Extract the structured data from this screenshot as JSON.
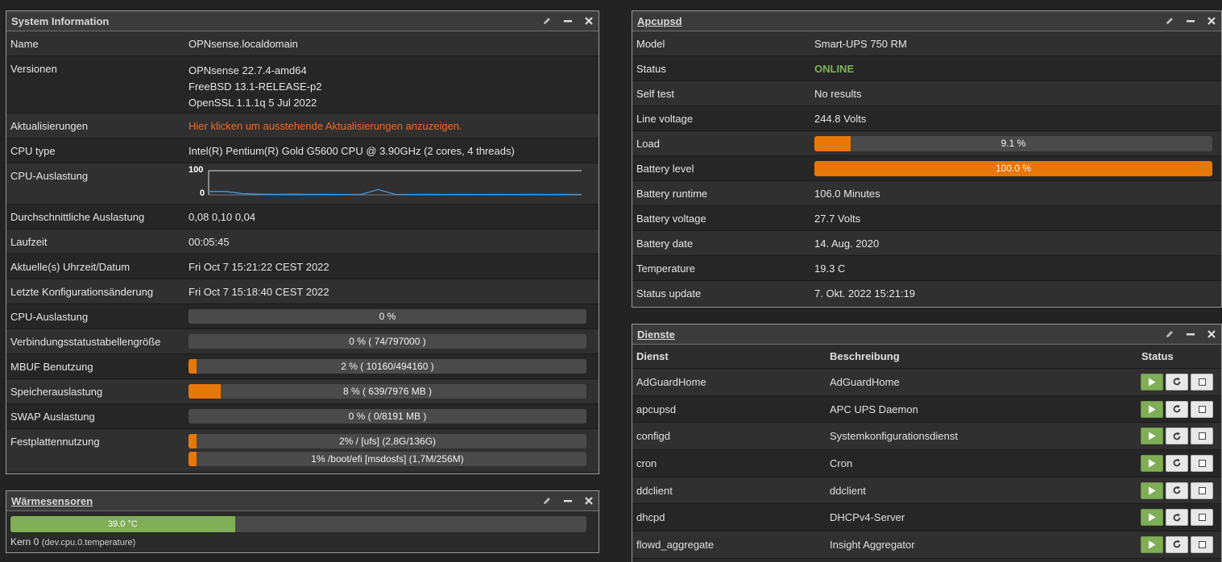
{
  "system": {
    "title": "System Information",
    "rows": {
      "name_label": "Name",
      "name_value": "OPNsense.localdomain",
      "versions_label": "Versionen",
      "versions": [
        "OPNsense 22.7.4-amd64",
        "FreeBSD 13.1-RELEASE-p2",
        "OpenSSL 1.1.1q 5 Jul 2022"
      ],
      "updates_label": "Aktualisierungen",
      "updates_value": "Hier klicken um ausstehende Aktualisierungen anzuzeigen.",
      "cputype_label": "CPU type",
      "cputype_value": "Intel(R) Pentium(R) Gold G5600 CPU @ 3.90GHz (2 cores, 4 threads)",
      "cpuusage_graph_label": "CPU-Auslastung",
      "graph_max": "100",
      "graph_min": "0",
      "load_label": "Durchschnittliche Auslastung",
      "load_value": "0,08 0,10 0,04",
      "uptime_label": "Laufzeit",
      "uptime_value": "00:05:45",
      "datetime_label": "Aktuelle(s) Uhrzeit/Datum",
      "datetime_value": "Fri Oct 7 15:21:22 CEST 2022",
      "lastconfig_label": "Letzte Konfigurationsänderung",
      "lastconfig_value": "Fri Oct 7 15:18:40 CEST 2022",
      "cpu_bar_label": "CPU-Auslastung",
      "cpu_bar_text": "0 %",
      "cpu_bar_pct": 0,
      "states_label": "Verbindungsstatustabellengröße",
      "states_text": "0 % ( 74/797000 )",
      "states_pct": 0,
      "mbuf_label": "MBUF Benutzung",
      "mbuf_text": "2 % ( 10160/494160 )",
      "mbuf_pct": 2,
      "mem_label": "Speicherauslastung",
      "mem_text": "8 % ( 639/7976 MB )",
      "mem_pct": 8,
      "swap_label": "SWAP Auslastung",
      "swap_text": "0 % ( 0/8191 MB )",
      "swap_pct": 0,
      "disk_label": "Festplattennutzung",
      "disk1_text": "2% / [ufs] (2,8G/136G)",
      "disk1_pct": 2,
      "disk2_text": "1% /boot/efi [msdosfs] (1,7M/256M)",
      "disk2_pct": 1
    }
  },
  "cpu_graph_values": [
    14,
    14,
    5,
    3,
    2,
    3,
    2,
    2,
    1,
    2,
    22,
    2,
    1,
    2,
    1,
    2,
    1,
    2,
    1,
    2,
    1,
    2,
    1
  ],
  "thermal": {
    "title": "Wärmesensoren",
    "bar_text": "39.0 °C",
    "bar_pct": 39,
    "sensor_label": "Kern 0",
    "sensor_id": "(dev.cpu.0.temperature)"
  },
  "ups": {
    "title": "Apcupsd",
    "model_label": "Model",
    "model_value": "Smart-UPS 750 RM",
    "status_label": "Status",
    "status_value": "ONLINE",
    "selftest_label": "Self test",
    "selftest_value": "No results",
    "linevoltage_label": "Line voltage",
    "linevoltage_value": "244.8 Volts",
    "load_label": "Load",
    "load_text": "9.1 %",
    "load_pct": 9.1,
    "battery_label": "Battery level",
    "battery_text": "100.0 %",
    "battery_pct": 100,
    "runtime_label": "Battery runtime",
    "runtime_value": "106.0 Minutes",
    "battvolt_label": "Battery voltage",
    "battvolt_value": "27.7 Volts",
    "battdate_label": "Battery date",
    "battdate_value": "14. Aug. 2020",
    "temp_label": "Temperature",
    "temp_value": "19.3 C",
    "update_label": "Status update",
    "update_value": "7. Okt. 2022 15:21:19"
  },
  "services": {
    "title": "Dienste",
    "col_service": "Dienste",
    "col_service_head": "Dienst",
    "col_desc": "Beschreibung",
    "col_status": "Status",
    "rows": [
      {
        "name": "AdGuardHome",
        "desc": "AdGuardHome"
      },
      {
        "name": "apcupsd",
        "desc": "APC UPS Daemon"
      },
      {
        "name": "configd",
        "desc": "Systemkonfigurationsdienst"
      },
      {
        "name": "cron",
        "desc": "Cron"
      },
      {
        "name": "ddclient",
        "desc": "ddclient"
      },
      {
        "name": "dhcpd",
        "desc": "DHCPv4-Server"
      },
      {
        "name": "flowd_aggregate",
        "desc": "Insight Aggregator"
      }
    ]
  },
  "colors": {
    "accent": "#e8770a",
    "ok": "#7fae57",
    "warn_text": "#f06a2a"
  }
}
